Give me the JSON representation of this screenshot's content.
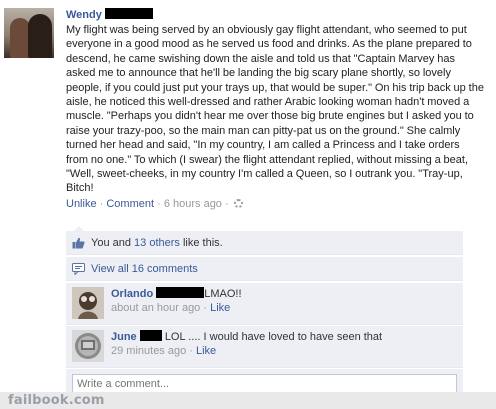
{
  "post": {
    "author": "Wendy",
    "message": "My flight was being served by an obviously gay flight attendant, who seemed to put everyone in a good mood as he served us food and drinks. As the plane prepared to descend, he came swishing down the aisle and told us that \"Captain Marvey has asked me to announce that he'll be landing the big scary plane shortly, so lovely people, if you could just put your trays up, that would be super.\" On his trip back up the aisle, he noticed this well-dressed and rather Arabic looking woman hadn't moved a muscle. \"Perhaps you didn't hear me over those big brute engines but I asked you to raise your trazy-poo, so the main man can pitty-pat us on the ground.\" She calmly turned her head and said, \"In my country, I am called a Princess and I take orders from no one.\" To which (I swear) the flight attendant replied, without missing a beat, \"Well, sweet-cheeks, in my country I'm called a Queen, so I outrank you. \"Tray-up, Bitch!",
    "unlike": "Unlike",
    "sep1": " · ",
    "comment": "Comment",
    "sep2": " · ",
    "time": "6 hours ago",
    "sep3": " · "
  },
  "likes": {
    "you": "You and ",
    "others": "13 others",
    "suffix": " like this."
  },
  "view_all": "View all 16 comments",
  "comments": [
    {
      "name": "Orlando",
      "text": "LMAO!!",
      "time": "about an hour ago",
      "sep": " · ",
      "like": "Like"
    },
    {
      "name": "June",
      "text": "LOL .... I would have loved to have seen that",
      "time": "29 minutes ago",
      "sep": " · ",
      "like": "Like"
    }
  ],
  "write_placeholder": "Write a comment...",
  "footer": "failbook.com",
  "colors": {
    "link": "#3b5998",
    "box": "#edeff4",
    "meta": "#999999"
  }
}
